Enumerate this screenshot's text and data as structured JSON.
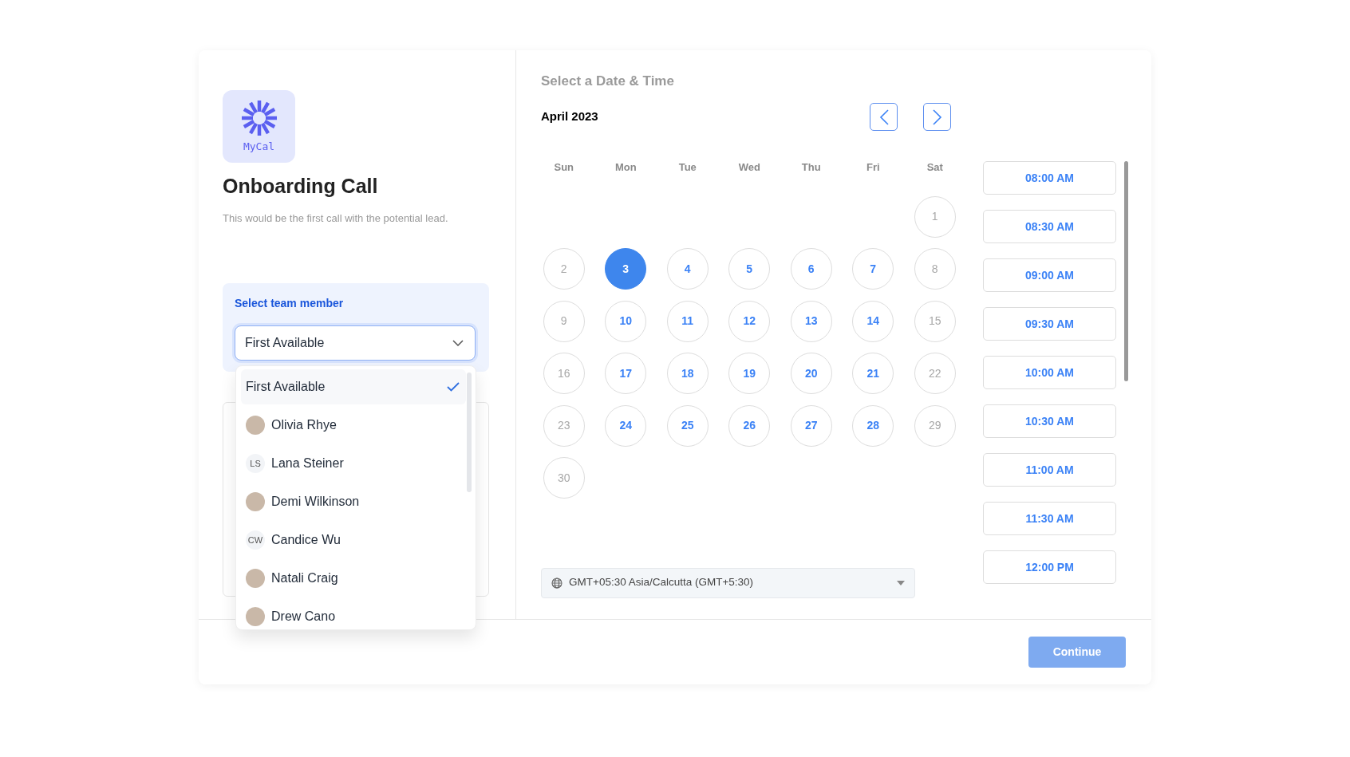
{
  "brand": {
    "logo_text": "MyCal"
  },
  "event": {
    "title": "Onboarding Call",
    "description": "This would be the first call with the potential lead."
  },
  "team_member": {
    "label": "Select team member",
    "value": "First Available",
    "expanded": true,
    "options": [
      {
        "name": "First Available",
        "kind": "plain",
        "selected": true
      },
      {
        "name": "Olivia Rhye",
        "kind": "photo",
        "selected": false
      },
      {
        "name": "Lana Steiner",
        "kind": "initials",
        "initials": "LS",
        "selected": false
      },
      {
        "name": "Demi Wilkinson",
        "kind": "photo",
        "selected": false
      },
      {
        "name": "Candice Wu",
        "kind": "initials",
        "initials": "CW",
        "selected": false
      },
      {
        "name": "Natali Craig",
        "kind": "photo",
        "selected": false
      },
      {
        "name": "Drew Cano",
        "kind": "photo",
        "selected": false
      }
    ]
  },
  "calendar": {
    "title": "Select a Date & Time",
    "month": "April 2023",
    "weekdays": [
      "Sun",
      "Mon",
      "Tue",
      "Wed",
      "Thu",
      "Fri",
      "Sat"
    ],
    "weeks": [
      {
        "kind": "opening",
        "days": [
          {
            "day": "1",
            "available": false,
            "selected": false
          }
        ]
      },
      {
        "kind": "full",
        "days": [
          {
            "day": "2",
            "available": false,
            "selected": false
          },
          {
            "day": "3",
            "available": true,
            "selected": true
          },
          {
            "day": "4",
            "available": true,
            "selected": false
          },
          {
            "day": "5",
            "available": true,
            "selected": false
          },
          {
            "day": "6",
            "available": true,
            "selected": false
          },
          {
            "day": "7",
            "available": true,
            "selected": false
          },
          {
            "day": "8",
            "available": false,
            "selected": false
          }
        ]
      },
      {
        "kind": "full",
        "days": [
          {
            "day": "9",
            "available": false,
            "selected": false
          },
          {
            "day": "10",
            "available": true,
            "selected": false
          },
          {
            "day": "11",
            "available": true,
            "selected": false
          },
          {
            "day": "12",
            "available": true,
            "selected": false
          },
          {
            "day": "13",
            "available": true,
            "selected": false
          },
          {
            "day": "14",
            "available": true,
            "selected": false
          },
          {
            "day": "15",
            "available": false,
            "selected": false
          }
        ]
      },
      {
        "kind": "full",
        "days": [
          {
            "day": "16",
            "available": false,
            "selected": false
          },
          {
            "day": "17",
            "available": true,
            "selected": false
          },
          {
            "day": "18",
            "available": true,
            "selected": false
          },
          {
            "day": "19",
            "available": true,
            "selected": false
          },
          {
            "day": "20",
            "available": true,
            "selected": false
          },
          {
            "day": "21",
            "available": true,
            "selected": false
          },
          {
            "day": "22",
            "available": false,
            "selected": false
          }
        ]
      },
      {
        "kind": "full",
        "days": [
          {
            "day": "23",
            "available": false,
            "selected": false
          },
          {
            "day": "24",
            "available": true,
            "selected": false
          },
          {
            "day": "25",
            "available": true,
            "selected": false
          },
          {
            "day": "26",
            "available": true,
            "selected": false
          },
          {
            "day": "27",
            "available": true,
            "selected": false
          },
          {
            "day": "28",
            "available": true,
            "selected": false
          },
          {
            "day": "29",
            "available": false,
            "selected": false
          }
        ]
      },
      {
        "kind": "closing",
        "days": [
          {
            "day": "30",
            "available": false,
            "selected": false
          }
        ]
      }
    ]
  },
  "time_slots": [
    "08:00 AM",
    "08:30 AM",
    "09:00 AM",
    "09:30 AM",
    "10:00 AM",
    "10:30 AM",
    "11:00 AM",
    "11:30 AM",
    "12:00 PM"
  ],
  "timezone": {
    "value": "GMT+05:30 Asia/Calcutta (GMT+5:30)"
  },
  "continue_button": {
    "label": "Continue",
    "disabled": true
  }
}
